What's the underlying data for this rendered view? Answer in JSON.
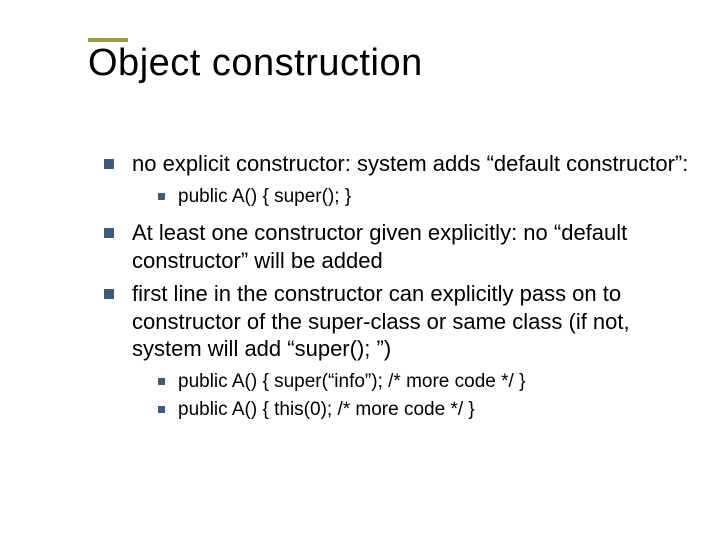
{
  "title": "Object construction",
  "bullets": [
    {
      "text": "no explicit constructor: system adds “default constructor”:",
      "sub": [
        "public A() { super(); }"
      ]
    },
    {
      "text": "At least one constructor given explicitly: no “default constructor” will be added",
      "sub": []
    },
    {
      "text": "first line in the constructor can explicitly pass on to constructor of the super-class or same class (if not, system will add “super(); ”)",
      "sub": [
        "public A() { super(“info”); /* more code */ }",
        "public A() { this(0); /* more code */ }"
      ]
    }
  ]
}
